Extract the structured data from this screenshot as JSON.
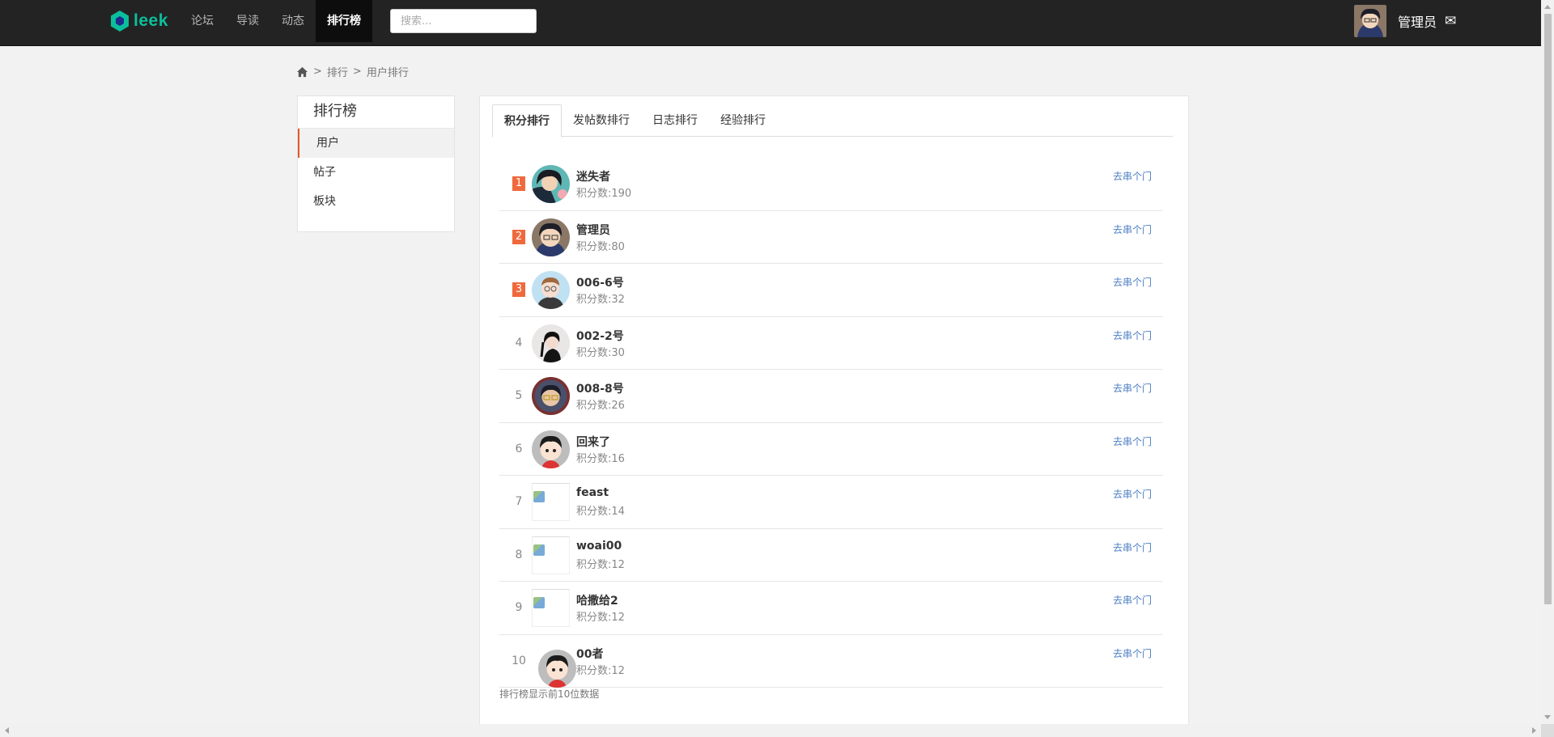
{
  "header": {
    "logo_text": "leek",
    "nav": [
      {
        "label": "论坛",
        "active": false
      },
      {
        "label": "导读",
        "active": false
      },
      {
        "label": "动态",
        "active": false
      },
      {
        "label": "排行榜",
        "active": true
      }
    ],
    "search_placeholder": "搜索...",
    "user_name": "管理员",
    "mail_icon": "✉"
  },
  "breadcrumb": {
    "sep": ">",
    "items": [
      "排行",
      "用户排行"
    ]
  },
  "sidebar": {
    "title": "排行榜",
    "items": [
      {
        "label": "用户",
        "active": true
      },
      {
        "label": "帖子",
        "active": false
      },
      {
        "label": "板块",
        "active": false
      }
    ]
  },
  "tabs": [
    {
      "label": "积分排行",
      "active": true
    },
    {
      "label": "发帖数排行",
      "active": false
    },
    {
      "label": "日志排行",
      "active": false
    },
    {
      "label": "经验排行",
      "active": false
    }
  ],
  "visit_label": "去串个门",
  "ranking": [
    {
      "rank": "1",
      "name": "迷失者",
      "score": "积分数:190",
      "avatar": "anime-dark"
    },
    {
      "rank": "2",
      "name": "管理员",
      "score": "积分数:80",
      "avatar": "anime-glasses"
    },
    {
      "rank": "3",
      "name": "006-6号",
      "score": "积分数:32",
      "avatar": "cartoon-man"
    },
    {
      "rank": "4",
      "name": "002-2号",
      "score": "积分数:30",
      "avatar": "anime-girl"
    },
    {
      "rank": "5",
      "name": "008-8号",
      "score": "积分数:26",
      "avatar": "anime-glasses-red"
    },
    {
      "rank": "6",
      "name": "回来了",
      "score": "积分数:16",
      "avatar": "cartoon-boy"
    },
    {
      "rank": "7",
      "name": "feast",
      "score": "积分数:14",
      "avatar": "broken-image"
    },
    {
      "rank": "8",
      "name": "woai00",
      "score": "积分数:12",
      "avatar": "broken-image"
    },
    {
      "rank": "9",
      "name": "哈撒给2",
      "score": "积分数:12",
      "avatar": "broken-image"
    },
    {
      "rank": "10",
      "name": "00者",
      "score": "积分数:12",
      "avatar": "cartoon-boy"
    }
  ],
  "footer_note": "排行榜显示前10位数据",
  "colors": {
    "header_bg": "#232323",
    "accent": "#0bbf9c",
    "rank_badge": "#f0693c",
    "link": "#4a7dc4",
    "sidebar_active_border": "#e8562a"
  }
}
